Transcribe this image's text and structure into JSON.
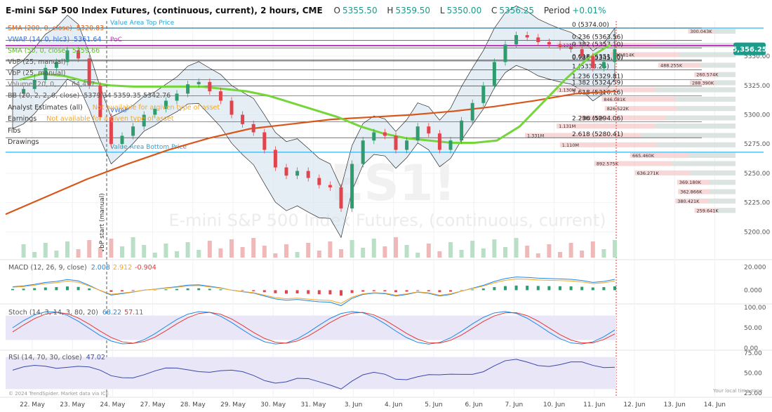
{
  "header": {
    "title": "E-mini S&P 500 Index Futures, (continuous, current), 2 hours, CME",
    "open_label": "O",
    "open": "5355.50",
    "high_label": "H",
    "high": "5359.50",
    "low_label": "L",
    "low": "5350.00",
    "close_label": "C",
    "close": "5356.25",
    "period_label": "Period",
    "period": "+0.01%"
  },
  "watermark": {
    "symbol": "ES1!",
    "name": "E-mini S&P 500 Index Futures, (continuous, current)"
  },
  "legend": {
    "sma200": {
      "label": "SMA (200, 0, close)",
      "value": "5320.83",
      "color": "#e0601a"
    },
    "vwap": {
      "label": "VWAP (14, 0, hlc3)",
      "value": "5361.64",
      "color": "#3a6fd8"
    },
    "sma50": {
      "label": "SMA (50, 0, close)",
      "value": "5359.66",
      "color": "#74d63a"
    },
    "vbp25": {
      "label": "VbP (25, manual)"
    },
    "vbp25b": {
      "label": "VbP (25, manual)"
    },
    "volume": {
      "label": "Volume (20, 0, ...)",
      "value": "64,457"
    },
    "bb": {
      "label": "BB (20, 2, 2, 0, close)",
      "values": "5379.34  5359.35  5342.76"
    },
    "analyst": {
      "label": "Analyst Estimates (all)",
      "note": "Not available for a given type of asset"
    },
    "earnings": {
      "label": "Earnings",
      "note": "Not available for a given type of asset"
    },
    "fibs": {
      "label": "Fibs"
    },
    "drawings": {
      "label": "Drawings"
    }
  },
  "annotations": {
    "value_area_top": "Value Area Top Price",
    "value_area_bottom": "Value Area Bottom Price",
    "poc": "PoC",
    "vwap_tag": "VWAP",
    "vbp_start": "VbP start (manual)"
  },
  "price_tag": {
    "value": "5,356.25",
    "color": "#1a9c8a"
  },
  "fib_levels": [
    {
      "ratio": "0",
      "price": 5374.0,
      "label": "0 (5374.00)"
    },
    {
      "ratio": "0.236",
      "price": 5363.56,
      "label": "0.236 (5363.56)"
    },
    {
      "ratio": "0.382",
      "price": 5357.1,
      "label": "0.382 (5357.10)"
    },
    {
      "ratio": "0.618",
      "price": 5346.65,
      "label": "0.618 (5351.65)"
    },
    {
      "ratio": "0.786",
      "price": 5345.9,
      "label": "0.786 (5345.90)"
    },
    {
      "ratio": "1",
      "price": 5338.25,
      "label": "1 (5338.25)"
    },
    {
      "ratio": "1.236",
      "price": 5329.81,
      "label": "1.236 (5329.81)"
    },
    {
      "ratio": "1.382",
      "price": 5324.59,
      "label": "1.382 (5324.59)"
    },
    {
      "ratio": "1.618",
      "price": 5316.16,
      "label": "1.618 (5316.16)"
    },
    {
      "ratio": "2.236",
      "price": 5294.06,
      "label": "2.236 (5294.06)"
    },
    {
      "ratio": "2.618",
      "price": 5280.41,
      "label": "2.618 (5280.41)"
    }
  ],
  "vbp_labels": [
    {
      "text": "300.043K",
      "price": 5371
    },
    {
      "text": "1.131M",
      "price": 5359
    },
    {
      "text": "790.814K",
      "price": 5351
    },
    {
      "text": "488.255K",
      "price": 5342
    },
    {
      "text": "260.574K",
      "price": 5334
    },
    {
      "text": "288.390K",
      "price": 5327
    },
    {
      "text": "1.130M",
      "price": 5321
    },
    {
      "text": "846.081K",
      "price": 5313
    },
    {
      "text": "826.522K",
      "price": 5305
    },
    {
      "text": "982.618K",
      "price": 5297
    },
    {
      "text": "1.131M",
      "price": 5290
    },
    {
      "text": "1.331M",
      "price": 5282
    },
    {
      "text": "1.110M",
      "price": 5274
    },
    {
      "text": "665.460K",
      "price": 5265
    },
    {
      "text": "892.575K",
      "price": 5258
    },
    {
      "text": "636.271K",
      "price": 5250
    },
    {
      "text": "369.180K",
      "price": 5242
    },
    {
      "text": "362.866K",
      "price": 5234
    },
    {
      "text": "380.421K",
      "price": 5226
    },
    {
      "text": "259.641K",
      "price": 5218
    }
  ],
  "panes": {
    "macd": {
      "label": "MACD (12, 26, 9, close)",
      "v1": "2.008",
      "v2": "2.912",
      "v3": "-0.904"
    },
    "stoch": {
      "label": "Stoch (14, 3, 14, 3, 80, 20)",
      "v1": "68.22",
      "v2": "57.11"
    },
    "rsi": {
      "label": "RSI (14, 70, 30, close)",
      "v1": "47.02"
    }
  },
  "footer": {
    "copyright": "© 2024 TrendSpider. Market data via ICE",
    "local_time": "Your local time zone"
  },
  "chart_data": {
    "type": "candlestick",
    "title": "E-mini S&P 500 Index Futures, (continuous, current), 2 hours, CME",
    "x_ticks": [
      "22. May",
      "23. May",
      "24. May",
      "27. May",
      "28. May",
      "29. May",
      "30. May",
      "31. May",
      "3. Jun",
      "4. Jun",
      "5. Jun",
      "6. Jun",
      "7. Jun",
      "10. Jun",
      "11. Jun",
      "12. Jun",
      "13. Jun",
      "14. Jun"
    ],
    "price_axis": {
      "ticks": [
        "5350.00",
        "5325.00",
        "5300.00",
        "5275.00",
        "5250.00",
        "5225.00",
        "5200.00"
      ],
      "range": [
        5190,
        5380
      ]
    },
    "price_series_approx": [
      5318,
      5322,
      5330,
      5340,
      5345,
      5355,
      5348,
      5325,
      5298,
      5275,
      5282,
      5290,
      5300,
      5305,
      5312,
      5318,
      5326,
      5328,
      5320,
      5312,
      5300,
      5292,
      5285,
      5270,
      5255,
      5248,
      5252,
      5246,
      5240,
      5238,
      5220,
      5258,
      5278,
      5285,
      5282,
      5270,
      5278,
      5290,
      5284,
      5270,
      5278,
      5295,
      5310,
      5325,
      5345,
      5360,
      5368,
      5366,
      5362,
      5360,
      5358,
      5356,
      5350,
      5340,
      5345,
      5356
    ],
    "sma50_approx": [
      5330,
      5335,
      5333,
      5328,
      5325,
      5324,
      5324,
      5324,
      5324,
      5322,
      5320,
      5316,
      5310,
      5304,
      5298,
      5290,
      5284,
      5280,
      5278,
      5276,
      5276,
      5278,
      5290,
      5310,
      5330,
      5348,
      5360
    ],
    "sma200_approx": [
      5215,
      5230,
      5245,
      5258,
      5270,
      5280,
      5288,
      5292,
      5296,
      5298,
      5300,
      5303,
      5307,
      5312,
      5318,
      5320
    ],
    "macd": {
      "range": [
        -10,
        25
      ],
      "ticks": [
        "20.000",
        "0.000"
      ]
    },
    "stoch": {
      "range": [
        0,
        100
      ],
      "ticks": [
        "100.00",
        "50.00",
        "0.00"
      ]
    },
    "rsi": {
      "range": [
        25,
        75
      ],
      "ticks": [
        "75.00",
        "50.00",
        "25.00"
      ]
    }
  }
}
